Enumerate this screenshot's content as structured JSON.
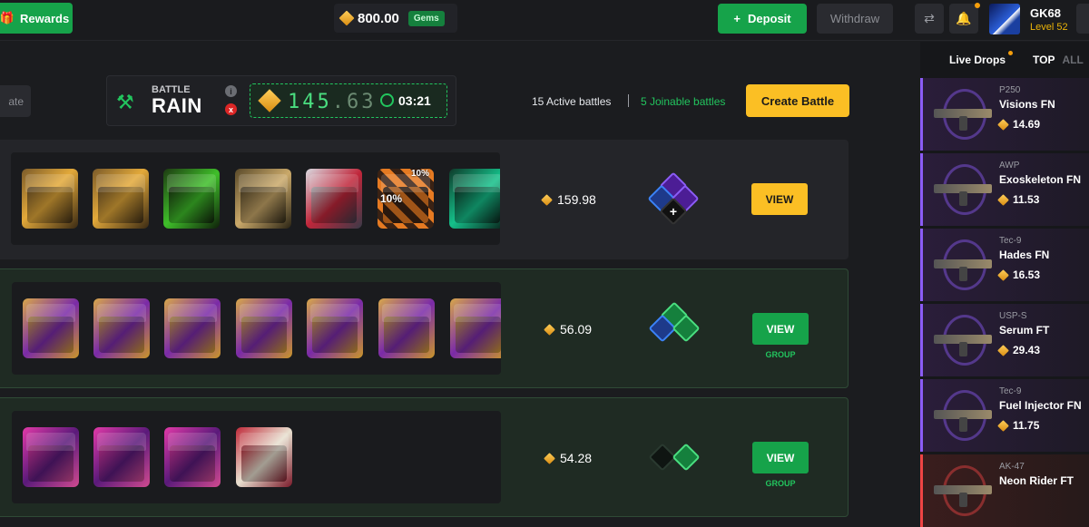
{
  "header": {
    "rewards_label": "Rewards",
    "balance": "800.00",
    "balance_unit": "Gems",
    "deposit_label": "Deposit",
    "withdraw_label": "Withdraw",
    "user": {
      "name": "GK68",
      "level": "Level 52"
    }
  },
  "rain": {
    "small_label": "BATTLE",
    "big_label": "RAIN",
    "amount_int": "145",
    "amount_dec": ".63",
    "timer": "03:21",
    "info": "i",
    "close": "x"
  },
  "battles_bar": {
    "private_label": "ate",
    "active": "15 Active battles",
    "joinable": "5 Joinable battles",
    "create_label": "Create Battle"
  },
  "battles": [
    {
      "price": "159.98",
      "view_label": "VIEW",
      "style": "yellow",
      "group": "",
      "badges": [
        "10%",
        "10%"
      ]
    },
    {
      "price": "56.09",
      "view_label": "VIEW",
      "style": "green",
      "group": "GROUP"
    },
    {
      "price": "54.28",
      "view_label": "VIEW",
      "style": "green",
      "group": "GROUP"
    }
  ],
  "sidebar": {
    "tabs": {
      "live": "Live Drops",
      "top": "TOP",
      "all": "ALL"
    },
    "drops": [
      {
        "type": "P250",
        "name": "Visions FN",
        "price": "14.69"
      },
      {
        "type": "AWP",
        "name": "Exoskeleton FN",
        "price": "11.53"
      },
      {
        "type": "Tec-9",
        "name": "Hades FN",
        "price": "16.53"
      },
      {
        "type": "USP-S",
        "name": "Serum FT",
        "price": "29.43"
      },
      {
        "type": "Tec-9",
        "name": "Fuel Injector FN",
        "price": "11.75"
      },
      {
        "type": "AK-47",
        "name": "Neon Rider FT",
        "price": ""
      }
    ]
  },
  "colors": {
    "accent_green": "#16a34a",
    "accent_yellow": "#fbbf24",
    "rarity_purple": "#8b5cf6",
    "rarity_red": "#ef4444"
  }
}
